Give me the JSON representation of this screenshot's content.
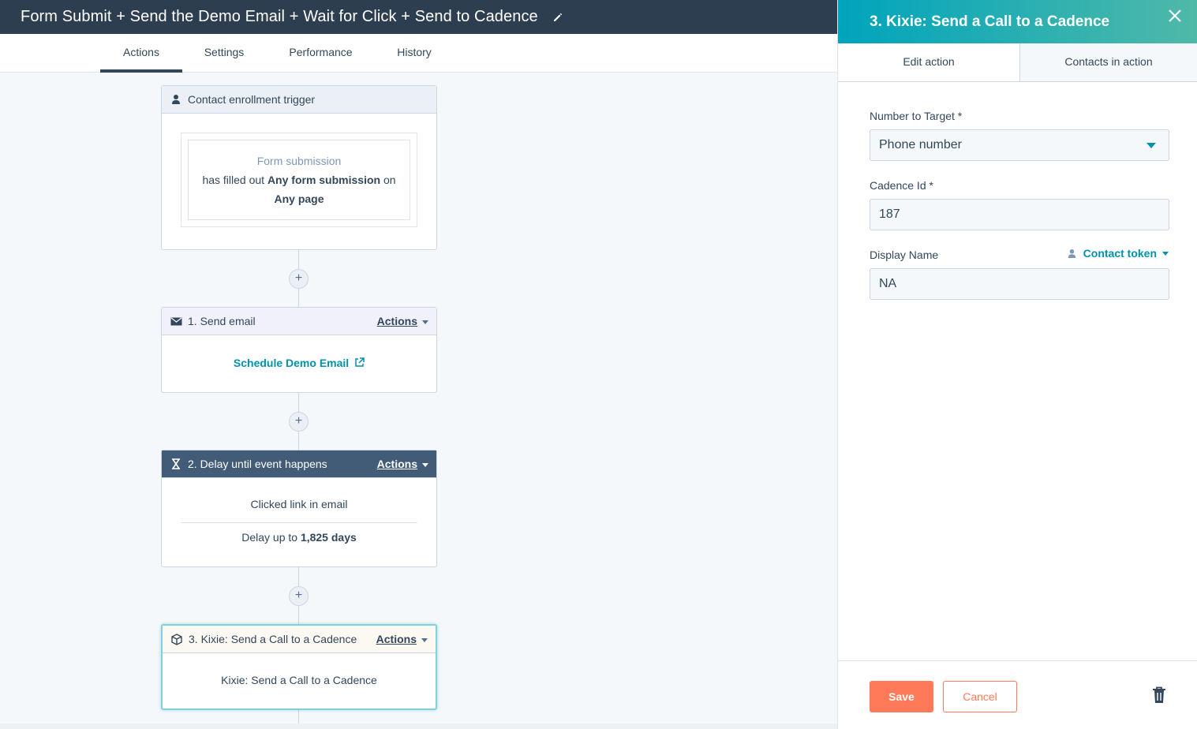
{
  "header": {
    "title": "Form Submit + Send the Demo Email + Wait for Click + Send to Cadence"
  },
  "tabs": [
    "Actions",
    "Settings",
    "Performance",
    "History"
  ],
  "workflow": {
    "trigger": {
      "label": "Contact enrollment trigger",
      "filter_type": "Form submission",
      "line1_pre": "has filled out",
      "line1_bold": "Any form submission",
      "line1_post": "on",
      "line2_bold": "Any page"
    },
    "step1": {
      "label": "1. Send email",
      "actions": "Actions",
      "link": "Schedule Demo Email"
    },
    "step2": {
      "label": "2. Delay until event happens",
      "actions": "Actions",
      "event": "Clicked link in email",
      "delay_pre": "Delay up to",
      "delay_bold": "1,825 days"
    },
    "step3": {
      "label": "3. Kixie: Send a Call to a Cadence",
      "actions": "Actions",
      "body": "Kixie: Send a Call to a Cadence"
    },
    "plus": "+"
  },
  "panel": {
    "title": "3. Kixie: Send a Call to a Cadence",
    "tabs": [
      "Edit action",
      "Contacts in action"
    ],
    "fields": {
      "number_label": "Number to Target *",
      "number_value": "Phone number",
      "cadence_label": "Cadence Id *",
      "cadence_value": "187",
      "display_label": "Display Name",
      "display_value": "NA",
      "token_label": "Contact token"
    },
    "buttons": {
      "save": "Save",
      "cancel": "Cancel"
    }
  },
  "colors": {
    "accent": "#00a4bd",
    "primary": "#ff7a59",
    "header": "#2d3e50"
  }
}
